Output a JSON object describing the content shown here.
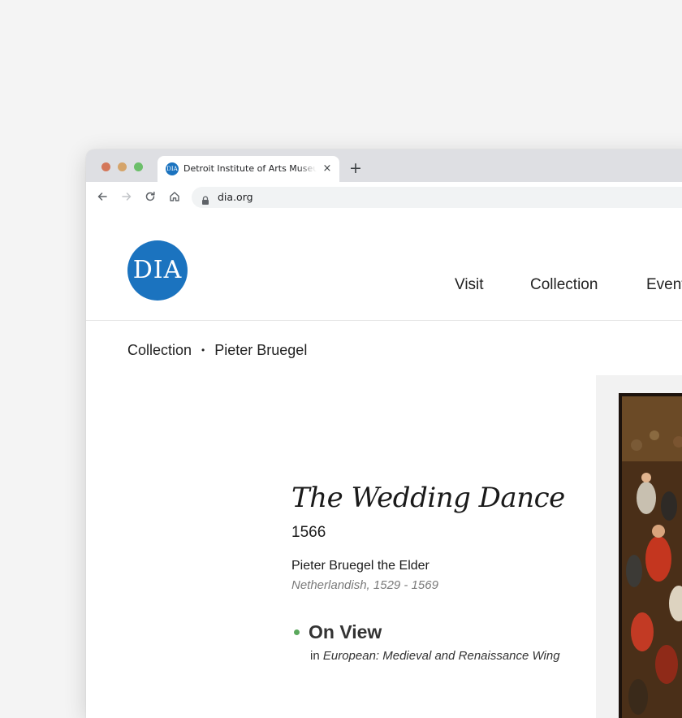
{
  "browser": {
    "tab": {
      "title": "Detroit Institute of Arts Museum",
      "favicon_text": "DIA",
      "close_glyph": "×"
    },
    "new_tab_glyph": "+",
    "url": "dia.org",
    "icons": [
      "back-icon",
      "forward-icon",
      "reload-icon",
      "home-icon",
      "lock-icon"
    ]
  },
  "site": {
    "logo_text": "DIA",
    "brand_color": "#1b73bf",
    "nav": [
      "Visit",
      "Collection",
      "Events"
    ]
  },
  "breadcrumb": {
    "items": [
      "Collection",
      "Pieter Bruegel"
    ],
    "separator": "•"
  },
  "artwork": {
    "title": "The Wedding Dance",
    "date": "1566",
    "artist": "Pieter Bruegel the Elder",
    "artist_meta": "Netherlandish, 1529 - 1569",
    "status": "On View",
    "status_color": "#5aa85c",
    "location_prefix": "in",
    "location": "European: Medieval and Renaissance Wing"
  }
}
